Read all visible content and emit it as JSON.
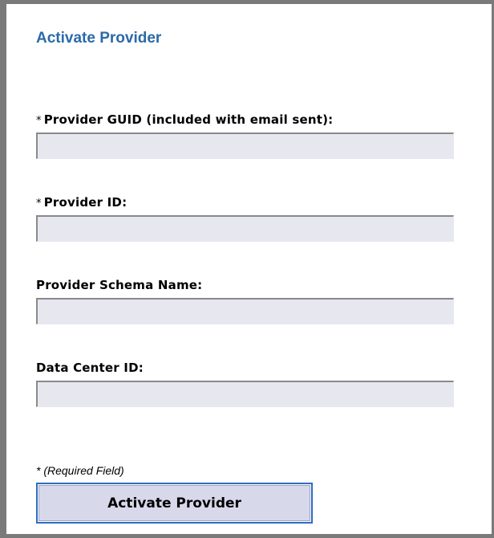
{
  "form": {
    "title": "Activate Provider",
    "required_marker": "*",
    "fields": [
      {
        "label": "Provider GUID (included with email sent):",
        "required": true,
        "value": "",
        "placeholder": ""
      },
      {
        "label": "Provider ID:",
        "required": true,
        "value": "",
        "placeholder": ""
      },
      {
        "label": "Provider Schema Name:",
        "required": false,
        "value": "",
        "placeholder": ""
      },
      {
        "label": "Data Center ID:",
        "required": false,
        "value": "",
        "placeholder": ""
      }
    ],
    "required_note": "* (Required Field)",
    "submit_label": "Activate Provider"
  },
  "colors": {
    "title": "#2a6aa8",
    "input_background": "#e6e7ef",
    "button_background": "#d7d8ea",
    "button_border": "#2f6cc0",
    "frame": "#7a7a7a"
  }
}
